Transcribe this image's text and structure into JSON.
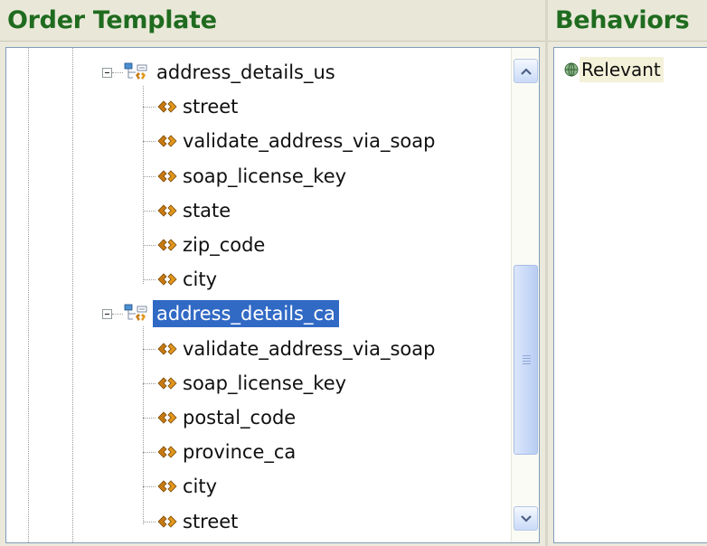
{
  "headers": {
    "order_template": "Order Template",
    "behaviors": "Behaviors"
  },
  "tree": {
    "groups": [
      {
        "label": "address_details_us",
        "expanded": true,
        "selected": false,
        "children": [
          "street",
          "validate_address_via_soap",
          "soap_license_key",
          "state",
          "zip_code",
          "city"
        ]
      },
      {
        "label": "address_details_ca",
        "expanded": true,
        "selected": true,
        "children": [
          "validate_address_via_soap",
          "soap_license_key",
          "postal_code",
          "province_ca",
          "city",
          "street"
        ]
      }
    ]
  },
  "behaviors": {
    "items": [
      {
        "label": "Relevant",
        "icon": "behavior-globe-icon"
      }
    ]
  },
  "colors": {
    "header_text": "#1f6b1f",
    "selection": "#316ac5",
    "field_icon": "#c97a12"
  }
}
